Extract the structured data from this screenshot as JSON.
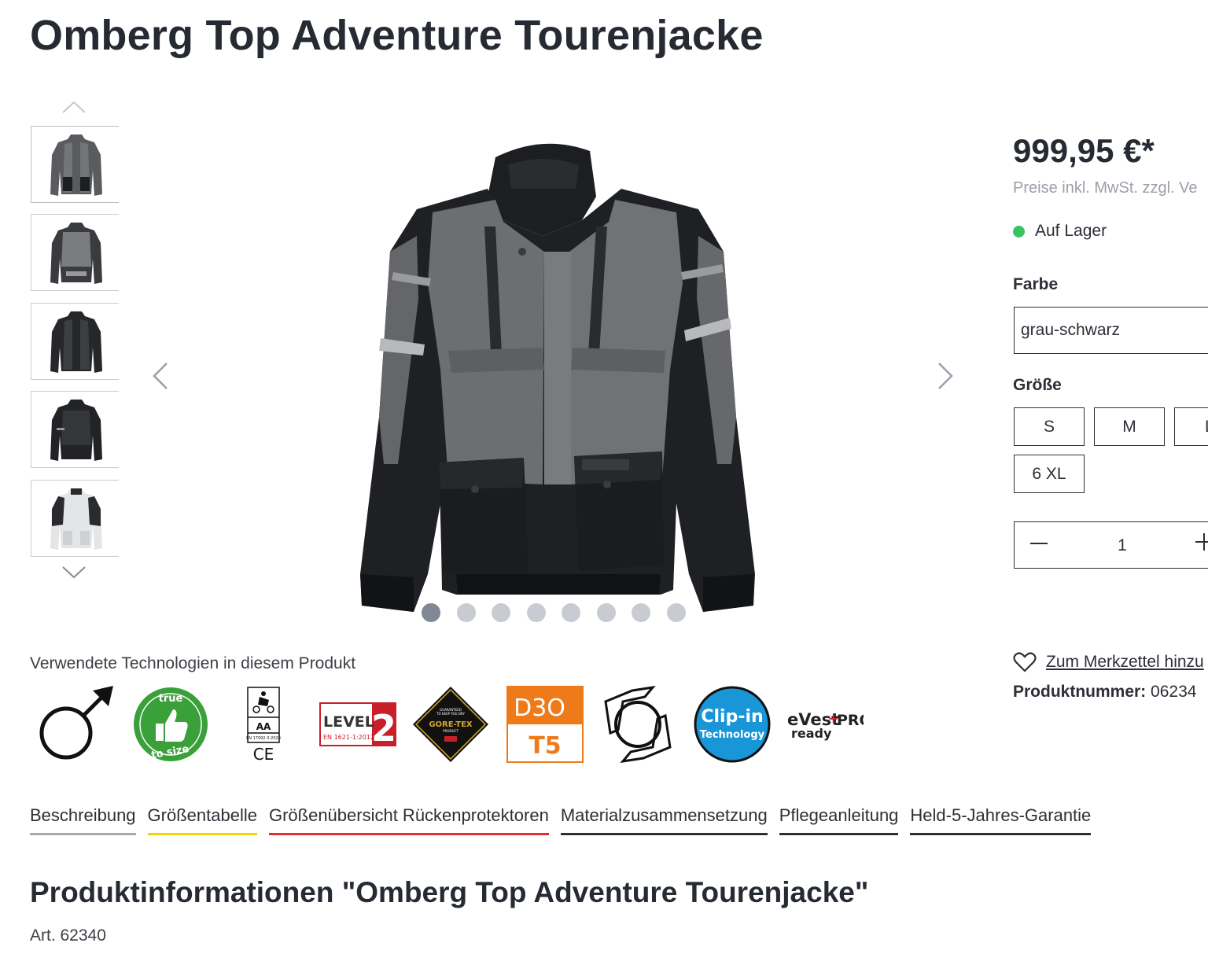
{
  "product": {
    "title": "Omberg Top Adventure Tourenjacke"
  },
  "gallery": {
    "thumbnail_count": 5,
    "dot_count": 8,
    "active_dot": 1
  },
  "buybox": {
    "price": "999,95 €*",
    "tax_note": "Preise inkl. MwSt. zzgl. Ve",
    "stock_label": "Auf Lager",
    "stock_color": "#3cc261",
    "color_label": "Farbe",
    "color_value": "grau-schwarz",
    "size_label": "Größe",
    "sizes": [
      "S",
      "M",
      "L",
      "6 XL"
    ],
    "quantity": "1",
    "wishlist_label": "Zum Merkzettel hinzu",
    "product_number_label": "Produktnummer:",
    "product_number_value": "06234"
  },
  "technologies": {
    "title": "Verwendete Technologien in diesem Produkt",
    "badges": {
      "true_to_size": {
        "top": "true",
        "bottom": "to size"
      },
      "ce": {
        "grade": "AA",
        "norm": "EN 17092-3:2020",
        "mark": "CE"
      },
      "level": {
        "word": "LEVEL",
        "number": "2",
        "norm": "EN 1621-1:2012"
      },
      "goretex": {
        "line1": "GUARANTEED",
        "line2": "TO KEEP YOU DRY",
        "brand": "GORE-TEX",
        "line3": "PRODUCT"
      },
      "d3o": {
        "brand": "D3O",
        "grade": "T5"
      },
      "clipin": {
        "line1": "Clip-in",
        "line2": "Technology"
      },
      "evest": {
        "brand": "eVest",
        "plus": "+",
        "pro": "PRO",
        "ready": "ready"
      }
    }
  },
  "tabs": [
    "Beschreibung",
    "Größentabelle",
    "Größenübersicht Rückenprotektoren",
    "Materialzusammensetzung",
    "Pflegeanleitung",
    "Held-5-Jahres-Garantie"
  ],
  "info": {
    "title": "Produktinformationen \"Omberg Top Adventure Tourenjacke\"",
    "article": "Art. 62340"
  }
}
